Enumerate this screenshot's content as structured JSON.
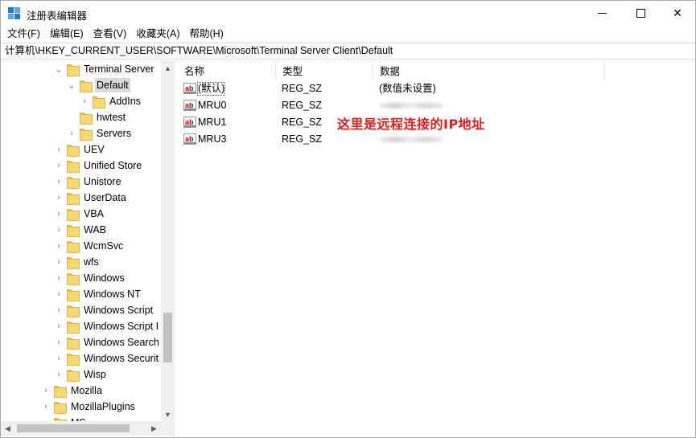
{
  "window": {
    "title": "注册表编辑器",
    "controls": {
      "minimize": "minimize",
      "maximize": "maximize",
      "close": "✕"
    }
  },
  "menu": [
    "文件(F)",
    "编辑(E)",
    "查看(V)",
    "收藏夹(A)",
    "帮助(H)"
  ],
  "address": "计算机\\HKEY_CURRENT_USER\\SOFTWARE\\Microsoft\\Terminal Server Client\\Default",
  "tree": {
    "items": [
      {
        "label": "Terminal Server",
        "chevron": "⌄",
        "selected": false
      },
      {
        "label": "Default",
        "chevron": "⌄",
        "selected": true
      },
      {
        "label": "AddIns",
        "chevron": "›",
        "selected": false
      },
      {
        "label": "hwtest",
        "chevron": "",
        "selected": false
      },
      {
        "label": "Servers",
        "chevron": "›",
        "selected": false
      },
      {
        "label": "UEV",
        "chevron": "›",
        "selected": false
      },
      {
        "label": "Unified Store",
        "chevron": "›",
        "selected": false
      },
      {
        "label": "Unistore",
        "chevron": "›",
        "selected": false
      },
      {
        "label": "UserData",
        "chevron": "›",
        "selected": false
      },
      {
        "label": "VBA",
        "chevron": "›",
        "selected": false
      },
      {
        "label": "WAB",
        "chevron": "›",
        "selected": false
      },
      {
        "label": "WcmSvc",
        "chevron": "›",
        "selected": false
      },
      {
        "label": "wfs",
        "chevron": "›",
        "selected": false
      },
      {
        "label": "Windows",
        "chevron": "›",
        "selected": false
      },
      {
        "label": "Windows NT",
        "chevron": "›",
        "selected": false
      },
      {
        "label": "Windows Script",
        "chevron": "›",
        "selected": false
      },
      {
        "label": "Windows Script I",
        "chevron": "›",
        "selected": false
      },
      {
        "label": "Windows Search",
        "chevron": "›",
        "selected": false
      },
      {
        "label": "Windows Securit",
        "chevron": "›",
        "selected": false
      },
      {
        "label": "Wisp",
        "chevron": "›",
        "selected": false
      },
      {
        "label": "Mozilla",
        "chevron": "›",
        "selected": false
      },
      {
        "label": "MozillaPlugins",
        "chevron": "›",
        "selected": false
      },
      {
        "label": "MS",
        "chevron": "›",
        "selected": false
      }
    ]
  },
  "values": {
    "headers": {
      "name": "名称",
      "type": "类型",
      "data": "数据"
    },
    "rows": [
      {
        "name": "(默认)",
        "type": "REG_SZ",
        "data": "(数值未设置)",
        "obscured": false
      },
      {
        "name": "MRU0",
        "type": "REG_SZ",
        "data": "",
        "obscured": true
      },
      {
        "name": "MRU1",
        "type": "REG_SZ",
        "data": "",
        "obscured": false
      },
      {
        "name": "MRU3",
        "type": "REG_SZ",
        "data": "",
        "obscured": true
      }
    ]
  },
  "annotation": "这里是远程连接的IP地址",
  "colors": {
    "annotation": "#e31c1c",
    "folder": "#f8d775",
    "selection": "#d9d9d9"
  }
}
